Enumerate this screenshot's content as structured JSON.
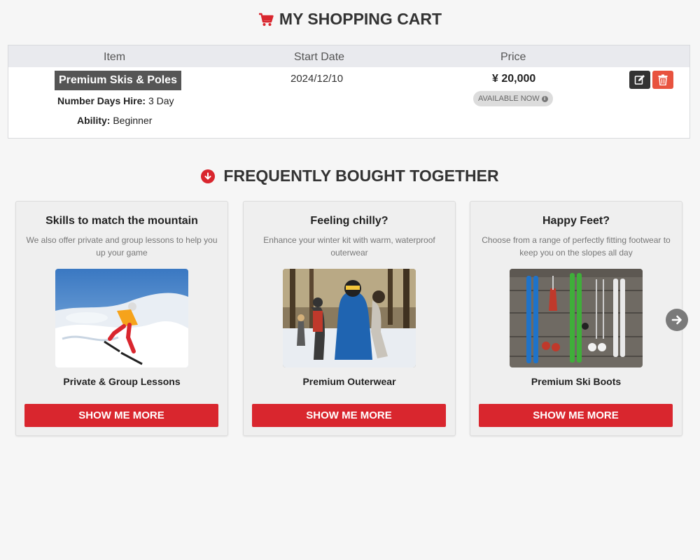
{
  "cart": {
    "title": "MY SHOPPING CART",
    "icon": "shopping-cart-icon",
    "accent_color": "#d9262e",
    "columns": {
      "item": "Item",
      "start_date": "Start Date",
      "price": "Price"
    },
    "items": [
      {
        "name": "Premium Skis & Poles",
        "hire_label": "Number Days Hire:",
        "hire_value": "3 Day",
        "ability_label": "Ability:",
        "ability_value": "Beginner",
        "start_date": "2024/12/10",
        "price": "¥ 20,000",
        "availability": "AVAILABLE NOW",
        "edit_icon": "edit-icon",
        "delete_icon": "trash-icon"
      }
    ]
  },
  "recommendations": {
    "title": "FREQUENTLY BOUGHT TOGETHER",
    "icon": "circle-arrow-down-icon",
    "cards": [
      {
        "heading": "Skills to match the mountain",
        "description": "We also offer private and group lessons to help you up your game",
        "image": "skier-photo",
        "product": "Private & Group Lessons",
        "button": "SHOW ME MORE"
      },
      {
        "heading": "Feeling chilly?",
        "description": "Enhance your winter kit with warm, waterproof outerwear",
        "image": "outerwear-photo",
        "product": "Premium Outerwear",
        "button": "SHOW ME MORE"
      },
      {
        "heading": "Happy Feet?",
        "description": "Choose from a range of perfectly fitting footwear to keep you on the slopes all day",
        "image": "ski-gear-photo",
        "product": "Premium Ski Boots",
        "button": "SHOW ME MORE"
      }
    ],
    "next_icon": "circle-chevron-right-icon"
  }
}
